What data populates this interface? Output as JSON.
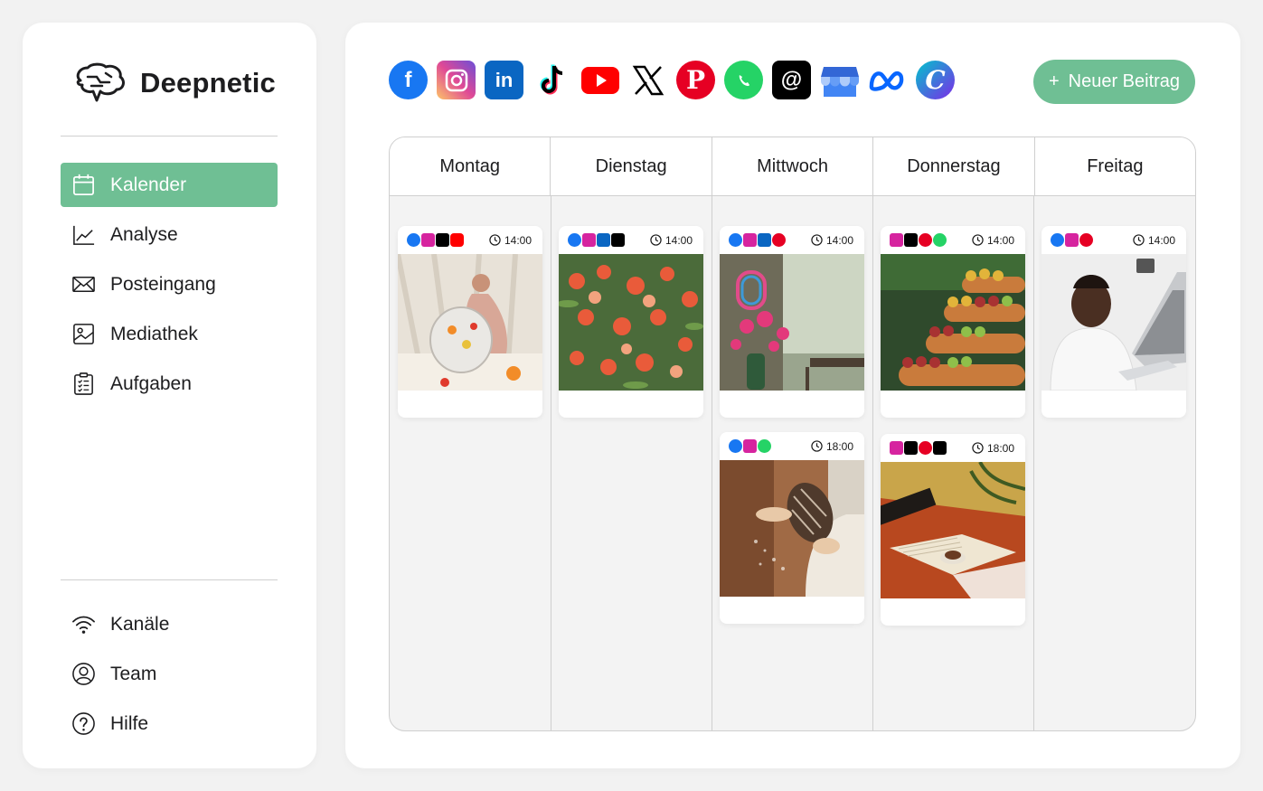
{
  "brand": {
    "name": "Deepnetic"
  },
  "nav": {
    "top": [
      {
        "label": "Kalender",
        "icon": "calendar-icon",
        "active": true
      },
      {
        "label": "Analyse",
        "icon": "chart-icon",
        "active": false
      },
      {
        "label": "Posteingang",
        "icon": "mail-icon",
        "active": false
      },
      {
        "label": "Mediathek",
        "icon": "image-icon",
        "active": false
      },
      {
        "label": "Aufgaben",
        "icon": "clipboard-icon",
        "active": false
      }
    ],
    "bottom": [
      {
        "label": "Kanäle",
        "icon": "wifi-icon"
      },
      {
        "label": "Team",
        "icon": "user-circle-icon"
      },
      {
        "label": "Hilfe",
        "icon": "help-icon"
      }
    ]
  },
  "channels": [
    "facebook",
    "instagram",
    "linkedin",
    "tiktok",
    "youtube",
    "x",
    "pinterest",
    "whatsapp",
    "threads",
    "google-business",
    "meta",
    "canva"
  ],
  "new_post_button": {
    "plus": "+",
    "label": "Neuer Beitrag"
  },
  "calendar": {
    "days": [
      "Montag",
      "Dienstag",
      "Mittwoch",
      "Donnerstag",
      "Freitag"
    ],
    "posts": [
      {
        "day": "Montag",
        "time": "14:00",
        "channels": [
          "facebook",
          "instagram",
          "tiktok",
          "youtube"
        ]
      },
      {
        "day": "Dienstag",
        "time": "14:00",
        "channels": [
          "facebook",
          "instagram",
          "linkedin",
          "threads"
        ]
      },
      {
        "day": "Mittwoch",
        "time": "14:00",
        "channels": [
          "facebook",
          "instagram",
          "linkedin",
          "pinterest"
        ]
      },
      {
        "day": "Donnerstag",
        "time": "14:00",
        "channels": [
          "instagram",
          "tiktok",
          "pinterest",
          "whatsapp"
        ]
      },
      {
        "day": "Freitag",
        "time": "14:00",
        "channels": [
          "facebook",
          "instagram",
          "pinterest"
        ]
      },
      {
        "day": "Mittwoch",
        "time": "18:00",
        "channels": [
          "facebook",
          "instagram",
          "whatsapp"
        ]
      },
      {
        "day": "Donnerstag",
        "time": "18:00",
        "channels": [
          "instagram",
          "tiktok",
          "pinterest",
          "threads"
        ]
      }
    ]
  },
  "colors": {
    "accent": "#6fbf94",
    "facebook": "#1877f2",
    "instagram": "#d6249f",
    "linkedin": "#0a66c2",
    "tiktok": "#000000",
    "youtube": "#ff0000",
    "pinterest": "#e60023",
    "whatsapp": "#25d366",
    "threads": "#000000",
    "google-business": "#4285f4",
    "meta": "#0866ff",
    "canva": "#00c4cc"
  }
}
